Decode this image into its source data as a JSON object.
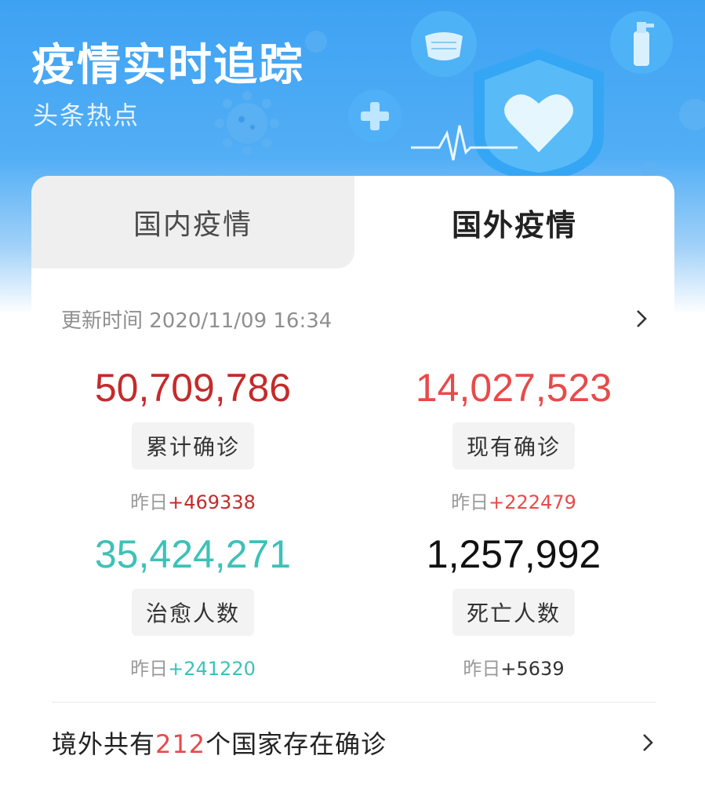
{
  "header": {
    "title": "疫情实时追踪",
    "subtitle": "头条热点"
  },
  "tabs": [
    {
      "label": "国内疫情",
      "active": false
    },
    {
      "label": "国外疫情",
      "active": true
    }
  ],
  "update": {
    "text": "更新时间 2020/11/09 16:34"
  },
  "stats": {
    "total_confirmed": {
      "value": "50,709,786",
      "label": "累计确诊",
      "delta_prefix": "昨日",
      "delta": "+469338",
      "color": "#c42b2b"
    },
    "current_confirmed": {
      "value": "14,027,523",
      "label": "现有确诊",
      "delta_prefix": "昨日",
      "delta": "+222479",
      "color": "#e84a4a"
    },
    "recovered": {
      "value": "35,424,271",
      "label": "治愈人数",
      "delta_prefix": "昨日",
      "delta": "+241220",
      "color": "#3cc2b8"
    },
    "deaths": {
      "value": "1,257,992",
      "label": "死亡人数",
      "delta_prefix": "昨日",
      "delta": "+5639",
      "color": "#111111"
    }
  },
  "footer": {
    "prefix": "境外共有",
    "count": "212",
    "suffix": "个国家存在确诊"
  },
  "icons": [
    "mask-icon",
    "spray-bottle-icon",
    "shield-heart-icon",
    "medical-cross-icon",
    "virus-icon",
    "heartbeat-icon",
    "chevron-right-icon"
  ],
  "colors": {
    "header_blue": "#3ea2f3",
    "accent_red": "#e84a4a"
  }
}
